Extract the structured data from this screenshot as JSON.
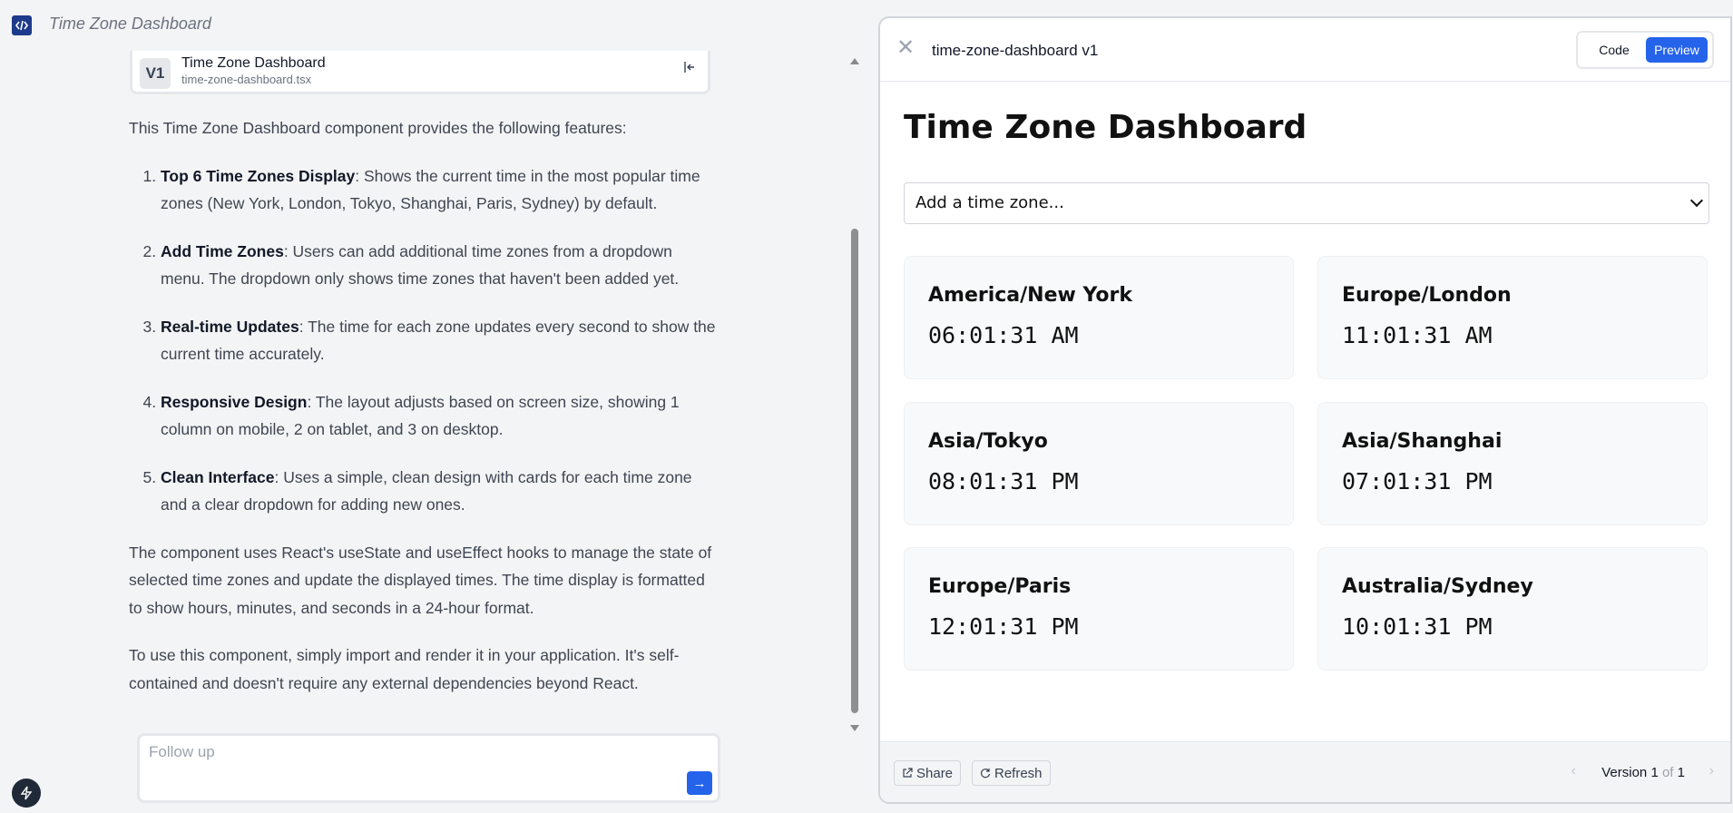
{
  "app": {
    "title": "Time Zone Dashboard",
    "logo_icon": "code-icon"
  },
  "artifact": {
    "badge": "V1",
    "name": "Time Zone Dashboard",
    "file": "time-zone-dashboard.tsx"
  },
  "chat": {
    "intro": "This Time Zone Dashboard component provides the following features:",
    "features": [
      {
        "title": "Top 6 Time Zones Display",
        "text": ": Shows the current time in the most popular time zones (New York, London, Tokyo, Shanghai, Paris, Sydney) by default."
      },
      {
        "title": "Add Time Zones",
        "text": ": Users can add additional time zones from a dropdown menu. The dropdown only shows time zones that haven't been added yet."
      },
      {
        "title": "Real-time Updates",
        "text": ": The time for each zone updates every second to show the current time accurately."
      },
      {
        "title": "Responsive Design",
        "text": ": The layout adjusts based on screen size, showing 1 column on mobile, 2 on tablet, and 3 on desktop."
      },
      {
        "title": "Clean Interface",
        "text": ": Uses a simple, clean design with cards for each time zone and a clear dropdown for adding new ones."
      }
    ],
    "para1": "The component uses React's useState and useEffect hooks to manage the state of selected time zones and update the displayed times. The time display is formatted to show hours, minutes, and seconds in a 24-hour format.",
    "para2": "To use this component, simply import and render it in your application. It's self-contained and doesn't require any external dependencies beyond React."
  },
  "followup": {
    "placeholder": "Follow up",
    "send_label": "→"
  },
  "panel": {
    "title": "time-zone-dashboard v1",
    "close_label": "✕",
    "code_label": "Code",
    "preview_label": "Preview",
    "dashboard_title": "Time Zone Dashboard",
    "select_placeholder": "Add a time zone...",
    "zones": [
      {
        "name": "America/New York",
        "time": "06:01:31 AM"
      },
      {
        "name": "Europe/London",
        "time": "11:01:31 AM"
      },
      {
        "name": "Asia/Tokyo",
        "time": "08:01:31 PM"
      },
      {
        "name": "Asia/Shanghai",
        "time": "07:01:31 PM"
      },
      {
        "name": "Europe/Paris",
        "time": "12:01:31 PM"
      },
      {
        "name": "Australia/Sydney",
        "time": "10:01:31 PM"
      }
    ],
    "share_label": "Share",
    "refresh_label": "Refresh",
    "version_word": "Version",
    "version_current": "1",
    "version_of": "of",
    "version_total": "1"
  },
  "colors": {
    "accent": "#2563eb",
    "logo_bg": "#1e3a8a"
  }
}
